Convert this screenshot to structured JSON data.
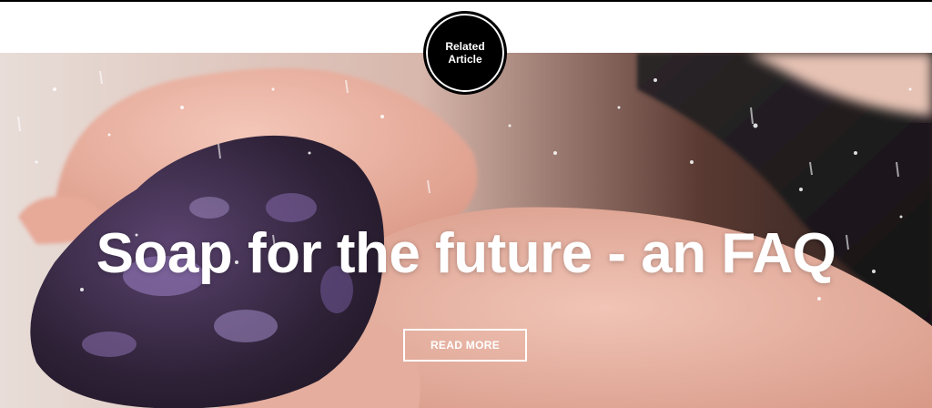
{
  "badge": {
    "line1": "Related",
    "line2": "Article"
  },
  "article": {
    "title": "Soap for the future - an FAQ",
    "cta_label": "READ MORE"
  },
  "colors": {
    "badge_background": "#000000",
    "text_on_image": "#ffffff",
    "soap": "#3a2a45",
    "skin": "#e9b6a6"
  },
  "icons": {
    "hero_image": "soap-in-hands-under-water-image"
  }
}
